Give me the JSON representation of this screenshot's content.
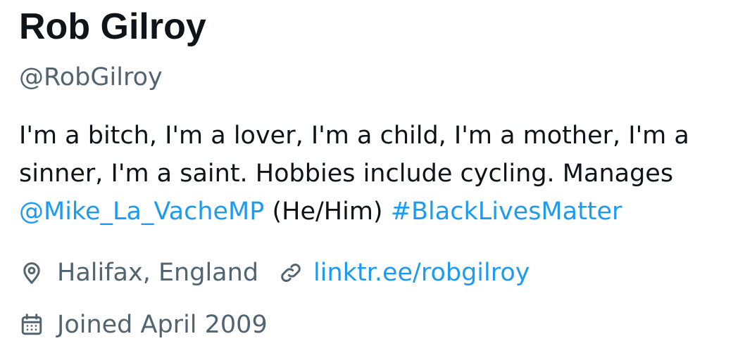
{
  "profile": {
    "display_name": "Rob Gilroy",
    "handle": "@RobGilroy",
    "bio": {
      "line1": "I'm a bitch, I'm a lover, I'm a child, I'm a mother, I'm a",
      "line2": "sinner, I'm a saint. Hobbies include cycling. Manages",
      "mention": "@Mike_La_VacheMP",
      "pronouns": " (He/Him) ",
      "hashtag": "#BlackLivesMatter"
    },
    "location": "Halifax, England",
    "website": "linktr.ee/robgilroy",
    "joined": "Joined April 2009"
  },
  "icons": {
    "location": "location-pin-icon",
    "website": "link-icon",
    "joined": "calendar-icon"
  },
  "colors": {
    "text_primary": "#0f1419",
    "text_secondary": "#536471",
    "link": "#1d9bf0"
  }
}
